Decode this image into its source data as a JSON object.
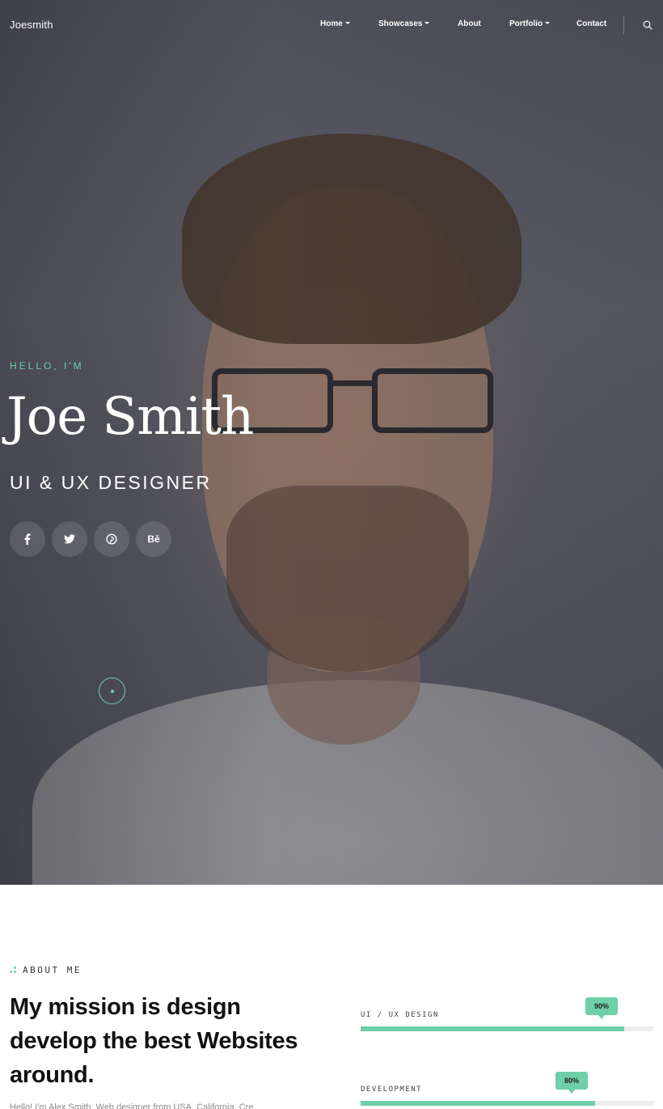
{
  "nav": {
    "logo": "Joesmith",
    "items": [
      {
        "label": "Home",
        "dropdown": true
      },
      {
        "label": "Showcases",
        "dropdown": true
      },
      {
        "label": "About",
        "dropdown": false
      },
      {
        "label": "Portfolio",
        "dropdown": true
      },
      {
        "label": "Contact",
        "dropdown": false
      }
    ],
    "search_icon": "search-icon"
  },
  "hero": {
    "eyebrow": "HELLO, I'M",
    "name": "Joe Smith",
    "role": "UI & UX DESIGNER",
    "socials": [
      {
        "icon": "facebook-icon",
        "glyph": "f"
      },
      {
        "icon": "twitter-icon",
        "glyph": "🐦"
      },
      {
        "icon": "pinterest-icon",
        "glyph": "℗"
      },
      {
        "icon": "behance-icon",
        "glyph": "Bē"
      }
    ],
    "accent": "#6fcfa8"
  },
  "about": {
    "label": "ABOUT ME",
    "heading": "My mission is design develop the best Websites around.",
    "intro": "Hello! I'm Alex Smith, Web designer from USA, California. Cre",
    "skills": [
      {
        "name": "UI / UX DESIGN",
        "percent_label": "90%",
        "value": 0.9
      },
      {
        "name": "DEVELOPMENT",
        "percent_label": "80%",
        "value": 0.8
      }
    ]
  }
}
